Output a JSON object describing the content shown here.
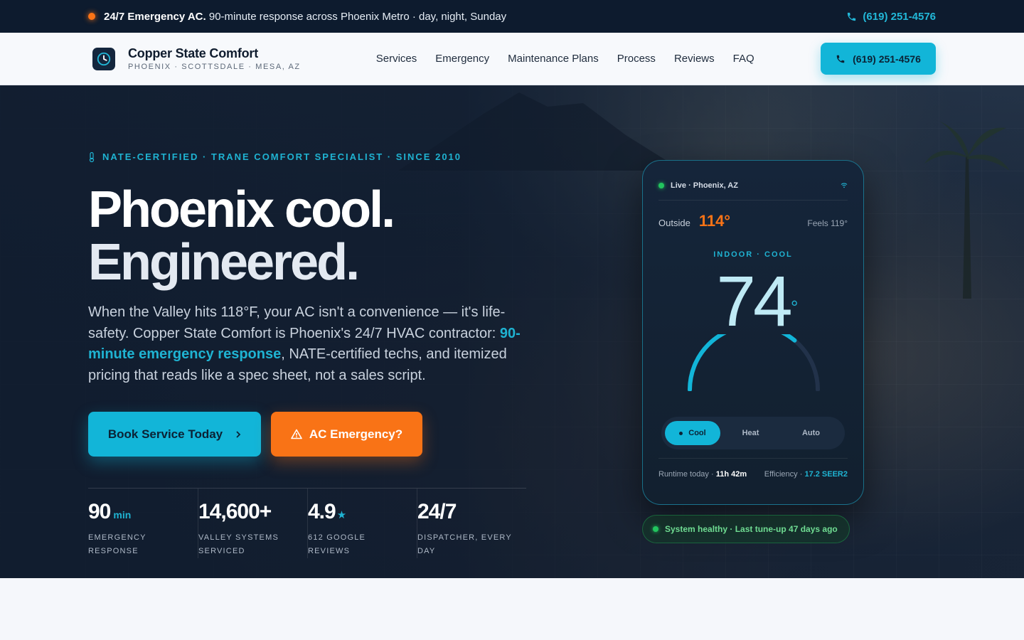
{
  "topbar": {
    "emergency_title": "24/7 Emergency AC.",
    "emergency_text": "90-minute response across Phoenix Metro · day, night, Sunday",
    "phone": "(619) 251-4576"
  },
  "nav": {
    "brand_name": "Copper State Comfort",
    "brand_sub": "PHOENIX · SCOTTSDALE · MESA, AZ",
    "links": [
      "Services",
      "Emergency",
      "Maintenance Plans",
      "Process",
      "Reviews",
      "FAQ"
    ],
    "cta_phone": "(619) 251-4576"
  },
  "hero": {
    "eyebrow": "NATE-CERTIFIED · TRANE COMFORT SPECIALIST · SINCE 2010",
    "headline_1": "Phoenix cool.",
    "headline_2": "Engineered.",
    "lead_1": "When the Valley hits 118°F, your AC isn't a convenience — it's life-safety. Copper State Comfort is Phoenix's 24/7 HVAC contractor: ",
    "lead_highlight": "90-minute emergency response",
    "lead_2": ", NATE-certified techs, and itemized pricing that reads like a spec sheet, not a sales script.",
    "btn_primary": "Book Service Today",
    "btn_emergency": "AC Emergency?",
    "stats": [
      {
        "value": "90",
        "unit": "min",
        "label": "EMERGENCY RESPONSE"
      },
      {
        "value": "14,600+",
        "unit": "",
        "label": "VALLEY SYSTEMS SERVICED"
      },
      {
        "value": "4.9",
        "unit": "★",
        "label": "612 GOOGLE REVIEWS"
      },
      {
        "value": "24/7",
        "unit": "",
        "label": "DISPATCHER, EVERY DAY"
      }
    ]
  },
  "thermostat": {
    "live_label": "Live · Phoenix, AZ",
    "outside_label": "Outside",
    "outside_temp": "114°",
    "feels": "Feels 119°",
    "mode_head": "INDOOR · COOL",
    "indoor_temp": "74",
    "degree": "°",
    "gauge_level": 0.72,
    "modes": [
      "Cool",
      "Heat",
      "Auto"
    ],
    "active_mode": "Cool",
    "runtime_label": "Runtime today ·",
    "runtime_value": "11h 42m",
    "efficiency_label": "Efficiency ·",
    "efficiency_value": "17.2 SEER2"
  },
  "health": {
    "text": "System healthy · Last tune-up 47 days ago"
  },
  "colors": {
    "accent": "#12b5d8",
    "emergency": "#f97316",
    "navy": "#0d1b2e",
    "healthy": "#22c55e"
  }
}
